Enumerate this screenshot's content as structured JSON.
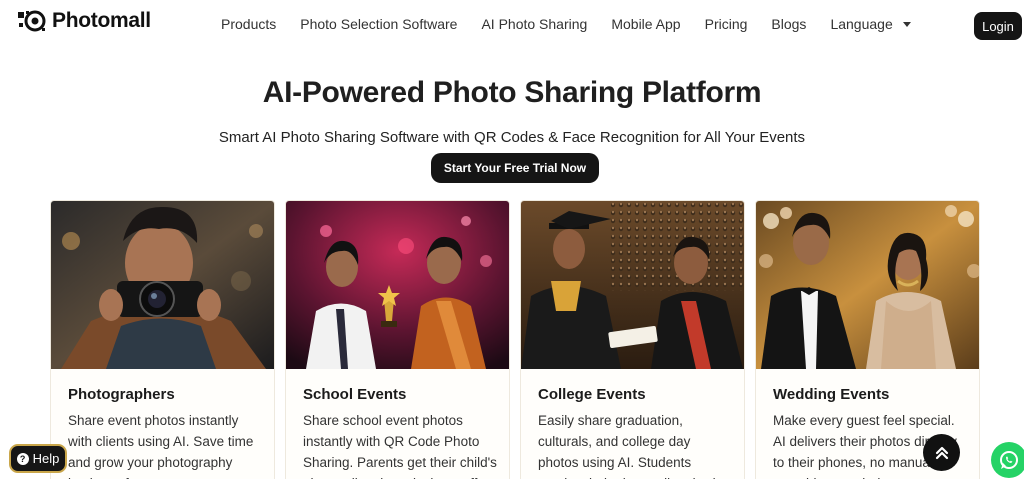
{
  "brand": {
    "name": "Photomall",
    "icon": "photomall-logo-icon"
  },
  "nav": {
    "items": [
      {
        "label": "Products"
      },
      {
        "label": "Photo Selection Software"
      },
      {
        "label": "AI Photo Sharing"
      },
      {
        "label": "Mobile App"
      },
      {
        "label": "Pricing"
      },
      {
        "label": "Blogs"
      },
      {
        "label": "Language"
      }
    ],
    "login_label": "Login"
  },
  "hero": {
    "title": "AI-Powered Photo Sharing Platform",
    "subtitle": "Smart AI Photo Sharing Software with QR Codes & Face Recognition for All Your Events",
    "cta_label": "Start Your Free Trial Now"
  },
  "cards": [
    {
      "title": "Photographers",
      "description": "Share event photos instantly with clients using AI. Save time and grow your photography business fast..."
    },
    {
      "title": "School Events",
      "description": "Share school event photos instantly with QR Code Photo Sharing. Parents get their child's photos directly, reducing staff..."
    },
    {
      "title": "College Events",
      "description": "Easily share graduation, culturals, and college day photos using AI. Students receive their photos directly, th..."
    },
    {
      "title": "Wedding Events",
      "description": "Make every guest feel special. AI delivers their photos directly to their phones, no manual searching needed..."
    }
  ],
  "floating": {
    "help_label": "Help",
    "help_icon": "question-icon",
    "scroll_top_icon": "double-chevron-up-icon",
    "whatsapp_icon": "whatsapp-icon"
  },
  "colors": {
    "primary_dark": "#151515",
    "help_border": "#c9a64a",
    "whatsapp": "#25d366"
  }
}
